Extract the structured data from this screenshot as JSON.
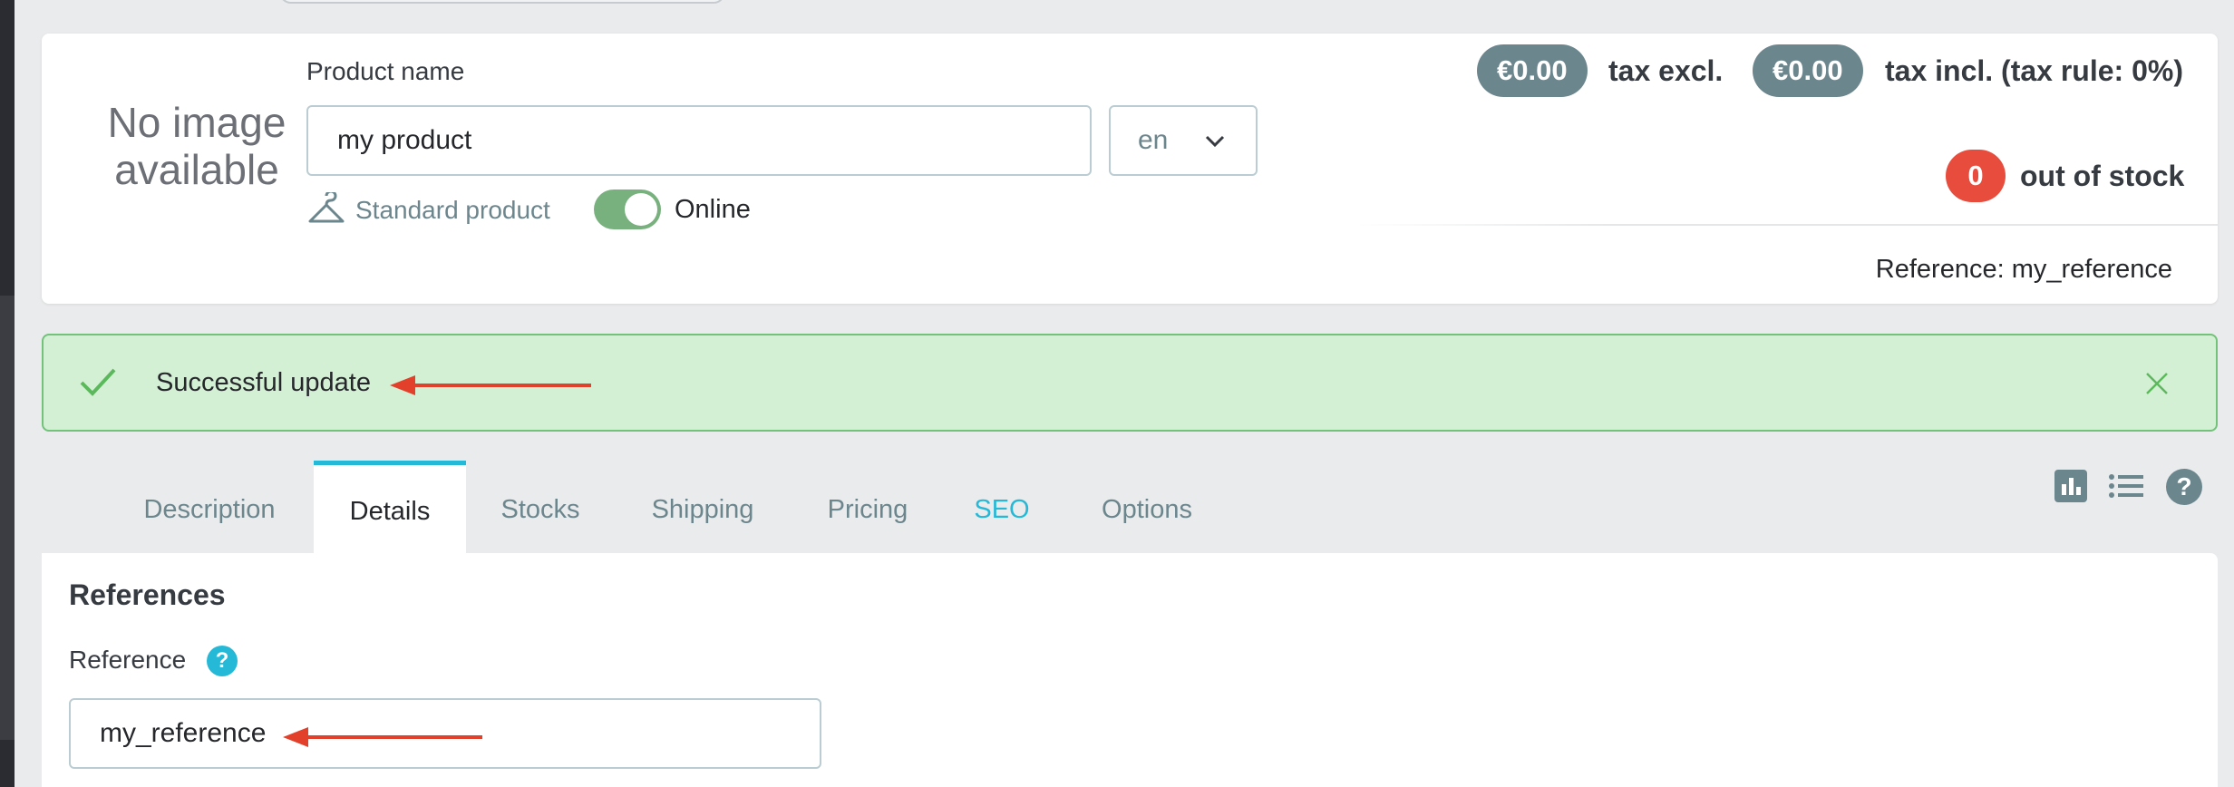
{
  "header": {
    "no_image_text": "No image available",
    "product_name_label": "Product name",
    "product_name_value": "my product",
    "language": "en",
    "product_type": "Standard product",
    "online_label": "Online",
    "online_enabled": true,
    "price_tax_excl": "€0.00",
    "tax_excl_label": "tax excl.",
    "price_tax_incl": "€0.00",
    "tax_incl_label": "tax incl. (tax rule: 0%)",
    "stock_count": "0",
    "stock_label": "out of stock",
    "reference_text": "Reference: my_reference"
  },
  "alert": {
    "message": "Successful update",
    "type": "success"
  },
  "tabs": [
    {
      "label": "Description",
      "active": false
    },
    {
      "label": "Details",
      "active": true
    },
    {
      "label": "Stocks",
      "active": false
    },
    {
      "label": "Shipping",
      "active": false
    },
    {
      "label": "Pricing",
      "active": false
    },
    {
      "label": "SEO",
      "active": false
    },
    {
      "label": "Options",
      "active": false
    }
  ],
  "toolbar_icons": [
    "stats-icon",
    "list-icon",
    "help-icon"
  ],
  "references": {
    "section_title": "References",
    "reference_label": "Reference",
    "help_symbol": "?",
    "reference_value": "my_reference"
  },
  "colors": {
    "accent": "#25b9d7",
    "badge_grey": "#6c868e",
    "danger": "#e74c3c",
    "success_bg": "#d4f0d4",
    "success_border": "#72c279",
    "annotation_arrow": "#e2402b"
  }
}
